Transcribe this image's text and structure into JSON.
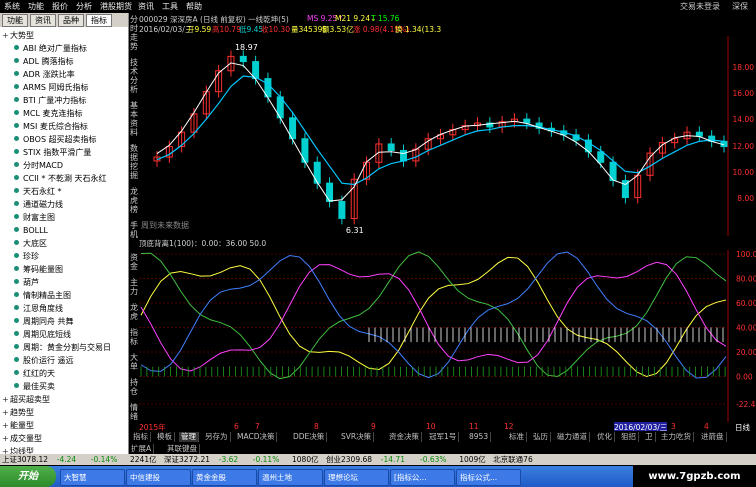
{
  "menubar": {
    "items": [
      "系统",
      "功能",
      "报价",
      "分析",
      "港股期货",
      "资讯",
      "工具",
      "帮助"
    ],
    "right_label": "交易未登录",
    "right_extra": "深保"
  },
  "left_panel": {
    "tabs": [
      "功能",
      "资讯",
      "品种",
      "指标"
    ],
    "active_tab": "指标",
    "tree": [
      {
        "label": "大势型",
        "type": "group"
      },
      {
        "label": "ABI 绝对广量指标",
        "type": "item"
      },
      {
        "label": "ADL 腾落指标",
        "type": "item"
      },
      {
        "label": "ADR 涨跌比率",
        "type": "item"
      },
      {
        "label": "ARMS 阿姆氏指标",
        "type": "item"
      },
      {
        "label": "BTI 广量冲力指标",
        "type": "item"
      },
      {
        "label": "MCL 麦克连指标",
        "type": "item"
      },
      {
        "label": "MSI 麦氏综合指标",
        "type": "item"
      },
      {
        "label": "OBOS 超买超卖指标",
        "type": "item"
      },
      {
        "label": "STIX 指数平滑广量",
        "type": "item"
      },
      {
        "label": "分时MACD",
        "type": "item"
      },
      {
        "label": "CCII * 不乾涮 天石永红",
        "type": "item"
      },
      {
        "label": "天石永红 *",
        "type": "item"
      },
      {
        "label": "通道磁力线",
        "type": "item"
      },
      {
        "label": "财富主图",
        "type": "item"
      },
      {
        "label": "BOLLL",
        "type": "item"
      },
      {
        "label": "大底区",
        "type": "item"
      },
      {
        "label": "珍珍",
        "type": "item"
      },
      {
        "label": "筹码能量图",
        "type": "item"
      },
      {
        "label": "葫芦",
        "type": "item"
      },
      {
        "label": "情制精品主图",
        "type": "item"
      },
      {
        "label": "江恩角度线",
        "type": "item"
      },
      {
        "label": "周期同舟 共舞",
        "type": "item"
      },
      {
        "label": "周期见底短线",
        "type": "item"
      },
      {
        "label": "周期：黄金分割与交易日",
        "type": "item"
      },
      {
        "label": "股价运行 遥远",
        "type": "item"
      },
      {
        "label": "红红的天",
        "type": "item"
      },
      {
        "label": "最佳买卖",
        "type": "item"
      },
      {
        "label": "超买超卖型",
        "type": "group"
      },
      {
        "label": "趋势型",
        "type": "group"
      },
      {
        "label": "能量型",
        "type": "group"
      },
      {
        "label": "成交量型",
        "type": "group"
      },
      {
        "label": "均线型",
        "type": "group"
      }
    ]
  },
  "vertical_tabs": [
    "分时走势",
    "技术分析",
    "基本资料",
    "数据挖掘",
    "龙虎榜",
    "手机"
  ],
  "vertical_tabs_lower": [
    "资金",
    "主力",
    "龙虎",
    "指标",
    "大单",
    "持仓",
    "情绪"
  ],
  "chart": {
    "info_line1": {
      "code": "000029 深深房A (日线 前复权) 一线乾坤(5)",
      "ms": "MS 9.25↑",
      "m21": "M21 9.24↓",
      "t": "T 15.76"
    },
    "info_line2": {
      "date": "2016/02/03/三",
      "open": "开9.59",
      "high": "高10.79",
      "low": "低9.45",
      "close": "收10.30",
      "amount": "量345395",
      "vol": "额3.53亿",
      "change": "涨 0.98(4.15%)",
      "turnover": "换 1.34(13.3"
    },
    "high_label": "18.97",
    "low_label": "6.31",
    "watermark_label": "周到未来数据",
    "price_ticks": [
      "18.00",
      "16.00",
      "14.00",
      "12.00",
      "10.00",
      "8.00"
    ],
    "indicator_header": "顶底背离1(100)：0.00：36.00  50.0",
    "indicator_ticks": [
      "100.00",
      "80.00",
      "60.00",
      "40.00",
      "20.00",
      "0.00",
      "-22.48"
    ],
    "date_labels": [
      "2015年",
      "6",
      "7",
      "8",
      "9",
      "10",
      "11",
      "12",
      "2016/02/03/三",
      "3",
      "4"
    ],
    "right_bottom": "日线"
  },
  "chart_data": {
    "type": "line",
    "title": "000029 深深房A (日线 前复权)",
    "xlabel": "",
    "ylabel": "",
    "ylim": [
      6,
      20
    ],
    "series": [
      {
        "name": "收盘",
        "values": [
          11.2,
          12.0,
          13.1,
          14.5,
          16.2,
          17.8,
          18.9,
          18.5,
          17.2,
          15.8,
          14.2,
          12.6,
          10.8,
          9.2,
          7.8,
          6.5,
          9.5,
          10.8,
          12.2,
          11.7,
          10.9,
          11.8,
          12.6,
          12.9,
          13.3,
          13.6,
          13.8,
          13.5,
          13.9,
          14.1,
          13.8,
          13.4,
          13.2,
          12.9,
          12.5,
          11.6,
          10.8,
          9.4,
          8.1,
          9.8,
          11.5,
          12.3,
          12.6,
          13.1,
          12.8,
          12.4,
          12.0
        ]
      },
      {
        "name": "MS",
        "values": [
          11.0,
          11.4,
          12.1,
          13.0,
          14.1,
          15.3,
          16.6,
          17.4,
          17.3,
          16.8,
          15.8,
          14.6,
          13.2,
          11.8,
          10.5,
          9.2,
          9.1,
          9.6,
          10.3,
          10.7,
          10.9,
          11.2,
          11.7,
          12.1,
          12.5,
          12.9,
          13.2,
          13.3,
          13.5,
          13.6,
          13.6,
          13.5,
          13.3,
          13.1,
          12.8,
          12.3,
          11.7,
          10.9,
          10.1,
          10.0,
          10.5,
          11.1,
          11.6,
          12.1,
          12.4,
          12.5,
          12.4
        ]
      }
    ]
  },
  "bottom_tabs": [
    "指标",
    "模板",
    "管理",
    "另存为",
    "MACD决策",
    "DDE决策",
    "SVR决策",
    "资金决策",
    "冠军1号",
    "8953",
    "标准",
    "弘历",
    "磁力通道",
    "优化",
    "狙招",
    "卫",
    "主力吃货",
    "进箭盘"
  ],
  "bottom_tab_active": "管理",
  "sub_tabs": [
    "扩展A",
    "其联键盘"
  ],
  "status_bar": {
    "items": [
      {
        "label": "上证3078.12",
        "color": "#000"
      },
      {
        "label": "-4.24",
        "color": "#0a8a0a"
      },
      {
        "label": "-0.14%",
        "color": "#0a8a0a"
      },
      {
        "label": "2241亿",
        "color": "#000"
      },
      {
        "label": "深证3272.21",
        "color": "#000"
      },
      {
        "label": "-3.62",
        "color": "#0a8a0a"
      },
      {
        "label": "-0.11%",
        "color": "#0a8a0a"
      },
      {
        "label": "1080亿",
        "color": "#000"
      },
      {
        "label": "创业2309.68",
        "color": "#000"
      },
      {
        "label": "-14.71",
        "color": "#0a8a0a"
      },
      {
        "label": "-0.63%",
        "color": "#0a8a0a"
      },
      {
        "label": "1009亿",
        "color": "#000"
      },
      {
        "label": "北京联通76",
        "color": "#000"
      }
    ]
  },
  "taskbar": {
    "start_label": "开始",
    "tasks": [
      "大智慧",
      "中信建投",
      "黄金金股",
      "温州土地",
      "理想论坛",
      "[指标公...",
      "指标公式..."
    ],
    "site": "www.7gpzb.com"
  },
  "colors": {
    "rise": "#ff3030",
    "fall": "#00d0d0",
    "ms_line": "#ffffff",
    "ma_line": "#00c8ff",
    "indicator_yellow": "#ffff40",
    "indicator_green": "#40c040",
    "indicator_magenta": "#ff40ff",
    "indicator_blue": "#4080ff"
  }
}
